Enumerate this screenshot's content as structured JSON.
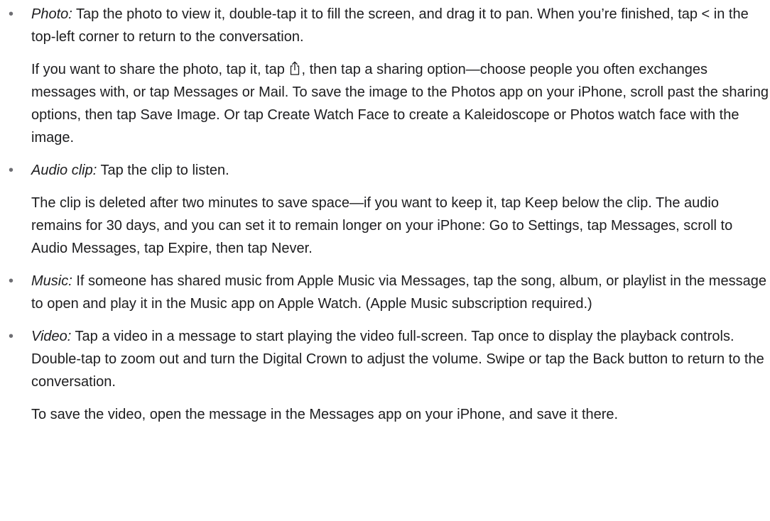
{
  "items": [
    {
      "term": "Photo:",
      "paragraphs": [
        {
          "text": " Tap the photo to view it, double-tap it to fill the screen, and drag it to pan. When you’re finished, tap < in the top-left corner to return to the conversation."
        },
        {
          "before_icon": "If you want to share the photo, tap it, tap ",
          "icon": "share-icon",
          "after_icon": ", then tap a sharing option—choose people you often exchanges messages with, or tap Messages or Mail. To save the image to the Photos app on your iPhone, scroll past the sharing options, then tap Save Image. Or tap Create Watch Face to create a Kaleidoscope or Photos watch face with the image."
        }
      ]
    },
    {
      "term": "Audio clip:",
      "paragraphs": [
        {
          "text": " Tap the clip to listen."
        },
        {
          "text": "The clip is deleted after two minutes to save space—if you want to keep it, tap Keep below the clip. The audio remains for 30 days, and you can set it to remain longer on your iPhone: Go to Settings, tap Messages, scroll to Audio Messages, tap Expire, then tap Never."
        }
      ]
    },
    {
      "term": "Music:",
      "paragraphs": [
        {
          "text": " If someone has shared music from Apple Music via Messages, tap the song, album, or playlist in the message to open and play it in the Music app on Apple Watch. (Apple Music subscription required.)"
        }
      ]
    },
    {
      "term": "Video:",
      "paragraphs": [
        {
          "text": " Tap a video in a message to start playing the video full-screen. Tap once to display the playback controls. Double-tap to zoom out and turn the Digital Crown to adjust the volume. Swipe or tap the Back button to return to the conversation."
        },
        {
          "text": "To save the video, open the message in the Messages app on your iPhone, and save it there."
        }
      ]
    }
  ],
  "bullet_char": "•",
  "colors": {
    "text": "#1d1d1f",
    "bullet": "#6e6e73"
  }
}
